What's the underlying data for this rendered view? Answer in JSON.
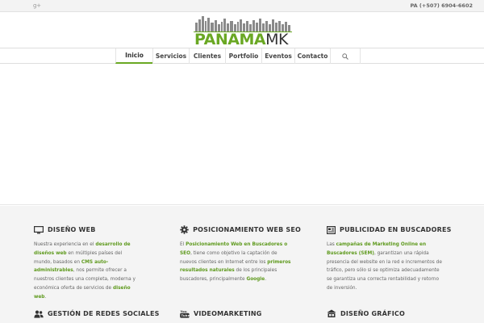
{
  "topbar": {
    "social_icon": "google-plus-icon",
    "social_label": "g+",
    "phone": "PA (+507) 6904-6602"
  },
  "logo": {
    "word_green": "PANAMA",
    "word_dark": "MK"
  },
  "nav": {
    "items": [
      {
        "label": "Inicio",
        "active": true
      },
      {
        "label": "Servicios"
      },
      {
        "label": "Clientes"
      },
      {
        "label": "Portfolio"
      },
      {
        "label": "Eventos"
      },
      {
        "label": "Contacto"
      }
    ],
    "search_icon": "search-icon"
  },
  "features": [
    {
      "icon": "monitor-icon",
      "title": "DISEÑO WEB",
      "body": [
        {
          "t": "Nuestra experiencia en el "
        },
        {
          "t": "desarrollo de diseños web",
          "g": true
        },
        {
          "t": " en múltiples países del mundo, basados en "
        },
        {
          "t": "CMS auto-administrables",
          "g": true
        },
        {
          "t": ", nos permite ofrecer a nuestros clientes una completa, moderna y económica oferta de servicios de "
        },
        {
          "t": "diseño web",
          "g": true
        },
        {
          "t": "."
        }
      ]
    },
    {
      "icon": "gear-icon",
      "title": "POSICIONAMIENTO WEB SEO",
      "body": [
        {
          "t": "El "
        },
        {
          "t": "Posicionamiento Web en Buscadores o SEO",
          "g": true
        },
        {
          "t": ", tiene como objetivo la captación de nuevos clientes en Internet entre los "
        },
        {
          "t": "primeros resultados naturales",
          "g": true
        },
        {
          "t": " de los principales buscadores, principalmente "
        },
        {
          "t": "Google",
          "g": true
        },
        {
          "t": "."
        }
      ]
    },
    {
      "icon": "ad-board-icon",
      "title": "PUBLICIDAD EN BUSCADORES",
      "body": [
        {
          "t": "Las "
        },
        {
          "t": "campañas de Marketing Online en Buscadores (SEM)",
          "g": true
        },
        {
          "t": ", garantizan una rápida presencia del website en la red e incrementos de tráfico, pero sólo si se optimiza adecuadamente se garantiza una correcta rentabilidad y retorno de inversión."
        }
      ]
    },
    {
      "icon": "users-icon",
      "title": "GESTIÓN DE REDES SOCIALES"
    },
    {
      "icon": "youtube-icon",
      "title": "VIDEOMARKETING",
      "icon_text": "You Tube"
    },
    {
      "icon": "palette-icon",
      "title": "DISEÑO GRÁFICO"
    }
  ]
}
